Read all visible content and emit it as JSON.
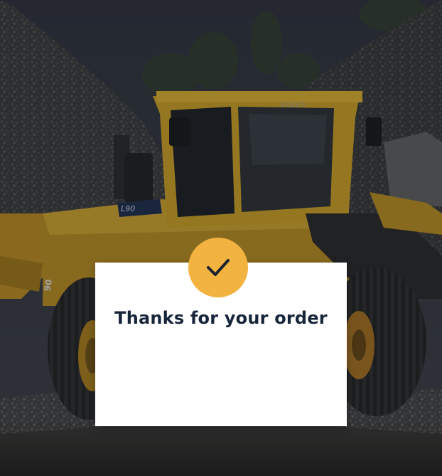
{
  "modal": {
    "title": "Thanks for your order",
    "accent_color": "#f2b340",
    "title_color": "#17253a",
    "icon": "checkmark-icon"
  },
  "background": {
    "subject": "yellow-wheel-loader-in-quarry",
    "loader_side_text": "L90",
    "loader_cab_text": "VOLVO",
    "loader_model_text": "90"
  }
}
